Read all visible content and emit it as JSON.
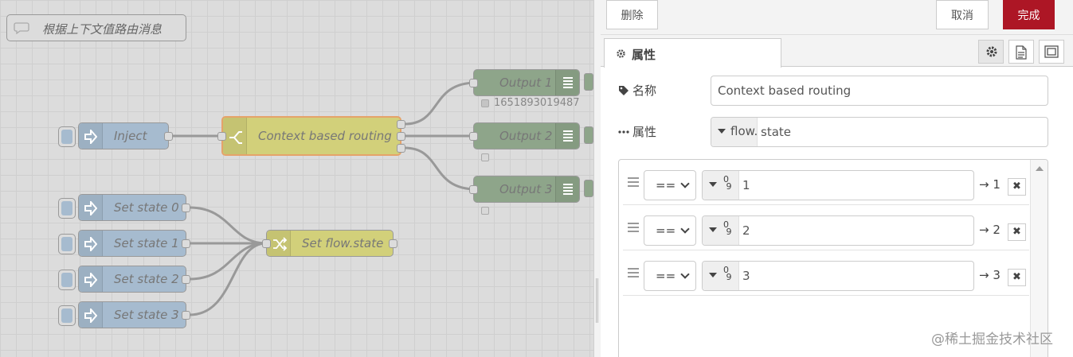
{
  "workspace": {
    "comment": "根据上下文值路由消息",
    "inject_node": "Inject",
    "switch_node": "Context based routing",
    "set_nodes": [
      "Set state 0",
      "Set state 1",
      "Set state 2",
      "Set state 3"
    ],
    "change_node": "Set flow.state",
    "debug_nodes": [
      "Output 1",
      "Output 2",
      "Output 3"
    ],
    "debug1_status": "1651893019487"
  },
  "toolbar": {
    "delete_label": "删除",
    "cancel_label": "取消",
    "done_label": "完成"
  },
  "tabs": {
    "properties_label": "属性"
  },
  "form": {
    "name_label": "名称",
    "name_value": "Context based routing",
    "property_label": "属性",
    "property_type": "flow.",
    "property_value": "state"
  },
  "rules": [
    {
      "operator": "==",
      "value": "1",
      "output": "→ 1"
    },
    {
      "operator": "==",
      "value": "2",
      "output": "→ 2"
    },
    {
      "operator": "==",
      "value": "3",
      "output": "→ 3"
    }
  ],
  "watermark": "@稀土掘金技术社区",
  "icons": {
    "comment": "speech-bubble-icon",
    "inject": "arrow-right-icon",
    "switch": "switch-icon",
    "change": "shuffle-icon",
    "debug": "list-icon",
    "tab": "gear-icon",
    "name": "tag-icon",
    "property": "ellipsis-icon"
  },
  "colors": {
    "accent": "#ad1625",
    "inject": "#a6bbcf",
    "change": "#d2d07a",
    "debug": "#8ea58a",
    "selected_outline": "#e5a36a"
  }
}
